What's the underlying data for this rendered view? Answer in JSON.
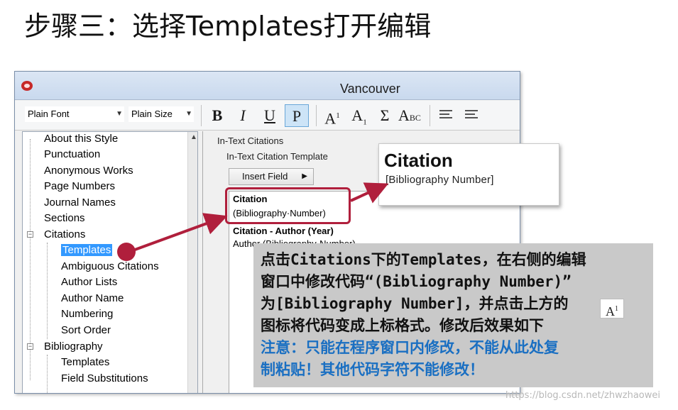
{
  "slide_title": "步骤三：选择Templates打开编辑",
  "window": {
    "title": "Vancouver"
  },
  "toolbar": {
    "font": "Plain Font",
    "size": "Plain Size",
    "bold": "B",
    "italic": "I",
    "underline": "U",
    "plain": "P",
    "superscript_base": "A",
    "superscript_mark": "1",
    "subscript_base": "A",
    "subscript_mark": "1",
    "sigma": "Σ",
    "smallcaps": "A",
    "smallcaps_tail": "BC"
  },
  "tree": {
    "items": [
      "About this Style",
      "Punctuation",
      "Anonymous Works",
      "Page Numbers",
      "Journal Names",
      "Sections",
      "Citations",
      "Templates",
      "Ambiguous Citations",
      "Author Lists",
      "Author Name",
      "Numbering",
      "Sort Order",
      "Bibliography",
      "Templates",
      "Field Substitutions"
    ],
    "expander_minus": "−"
  },
  "editor": {
    "section": "In-Text Citations",
    "group": "In-Text Citation Template",
    "insert_field": "Insert Field",
    "insert_arrow": "▶",
    "template1_heading": "Citation",
    "template1_code": "(Bibliography·Number)",
    "template2_heading": "Citation - Author (Year)",
    "template2_code": "Author (Bibliography·Number)"
  },
  "result": {
    "heading": "Citation",
    "code": "[Bibliography Number]"
  },
  "callout": {
    "line1": "点击Citations下的Templates，在右侧的编辑",
    "line2": "窗口中修改代码“(Bibliography Number)”",
    "line3": "为[Bibliography Number]，并点击上方的",
    "line4": "图标将代码变成上标格式。修改后效果如下",
    "warn1": "注意：只能在程序窗口内修改，不能从此处复",
    "warn2": "制粘贴！其他代码字符不能修改！",
    "badge_base": "A",
    "badge_mark": "1"
  },
  "watermark": "https://blog.csdn.net/zhwzhaowei",
  "colors": {
    "highlight": "#b01f3c",
    "selection": "#3399ff",
    "warning_text": "#1a6fc2",
    "callout_bg": "#c9c9c9"
  },
  "icons": [
    "endnote-app-icon",
    "align-left-icon",
    "align-justify-icon",
    "scroll-up-icon"
  ]
}
